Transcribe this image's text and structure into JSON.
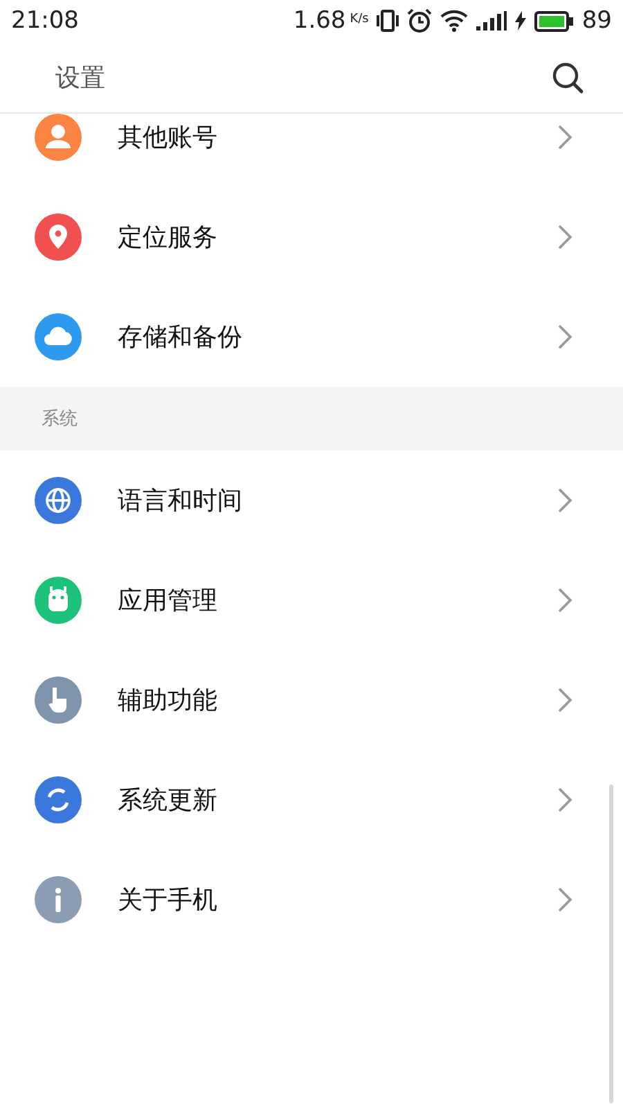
{
  "status_bar": {
    "time": "21:08",
    "speed": "1.68",
    "speed_unit": "K/s",
    "battery": "89"
  },
  "header": {
    "title": "设置"
  },
  "sections": [
    {
      "items": [
        {
          "label": "其他账号",
          "kind": "person",
          "color": "#fb8443"
        },
        {
          "label": "定位服务",
          "kind": "location",
          "color": "#f05050"
        },
        {
          "label": "存储和备份",
          "kind": "cloud",
          "color": "#2d9af0"
        }
      ]
    },
    {
      "title": "系统",
      "items": [
        {
          "label": "语言和时间",
          "kind": "globe",
          "color": "#3a78dc"
        },
        {
          "label": "应用管理",
          "kind": "android",
          "color": "#1cc27a"
        },
        {
          "label": "辅助功能",
          "kind": "hand",
          "color": "#7f95ac"
        },
        {
          "label": "系统更新",
          "kind": "refresh",
          "color": "#3a78dc"
        },
        {
          "label": "关于手机",
          "kind": "info",
          "color": "#8a9db3"
        }
      ]
    }
  ]
}
